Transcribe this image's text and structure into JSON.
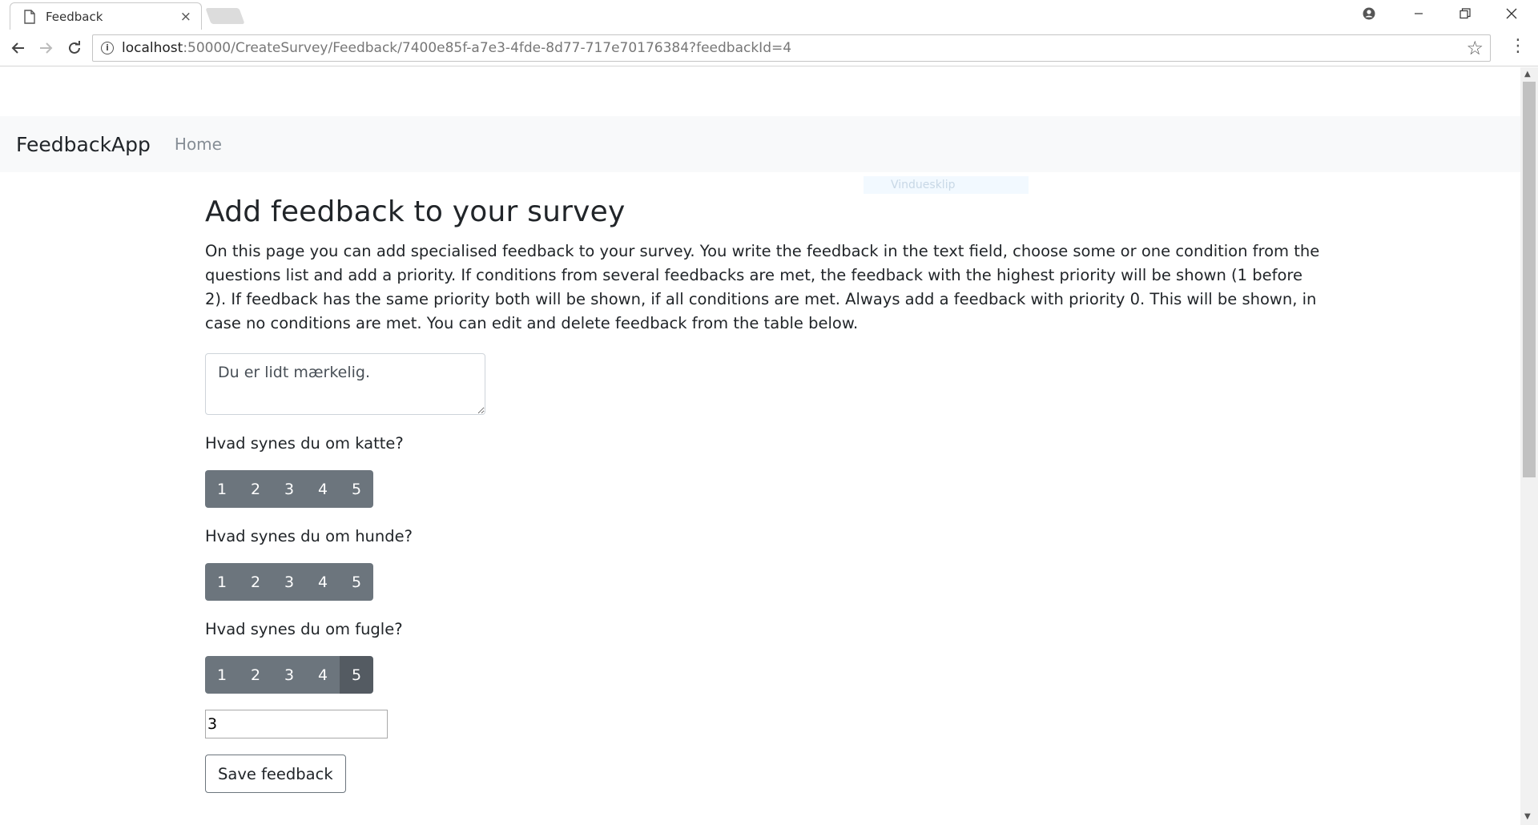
{
  "browser": {
    "tab_title": "Feedback",
    "tab_close": "×",
    "url_host": "localhost",
    "url_path": ":50000/CreateSurvey/Feedback/7400e85f-a7e3-4fde-8d77-717e70176384?feedbackId=4",
    "icons": [
      "page-icon",
      "account-icon",
      "minimize-icon",
      "restore-icon",
      "close-icon",
      "back-icon",
      "forward-icon",
      "reload-icon",
      "info-icon",
      "star-icon",
      "menu-icon"
    ]
  },
  "navbar": {
    "brand": "FeedbackApp",
    "home_link": "Home"
  },
  "overlay_label": "Vinduesklip",
  "page": {
    "title": "Add feedback to your survey",
    "description": "On this page you can add specialised feedback to your survey. You write the feedback in the text field, choose some or one condition from the questions list and add a priority. If conditions from several feedbacks are met, the feedback with the highest priority will be shown (1 before 2). If feedback has the same priority both will be shown, if all conditions are met. Always add a feedback with priority 0. This will be shown, in case no conditions are met. You can edit and delete feedback from the table below.",
    "feedback_text": "Du er lidt mærkelig.",
    "questions": [
      {
        "label": "Hvad synes du om katte?",
        "options": [
          "1",
          "2",
          "3",
          "4",
          "5"
        ],
        "selected": null
      },
      {
        "label": "Hvad synes du om hunde?",
        "options": [
          "1",
          "2",
          "3",
          "4",
          "5"
        ],
        "selected": null
      },
      {
        "label": "Hvad synes du om fugle?",
        "options": [
          "1",
          "2",
          "3",
          "4",
          "5"
        ],
        "selected": "5"
      }
    ],
    "priority_value": "3",
    "save_label": "Save feedback"
  },
  "colors": {
    "button": "#6c757d",
    "button_active": "#545b62",
    "navbar_bg": "#f8f9fa"
  }
}
